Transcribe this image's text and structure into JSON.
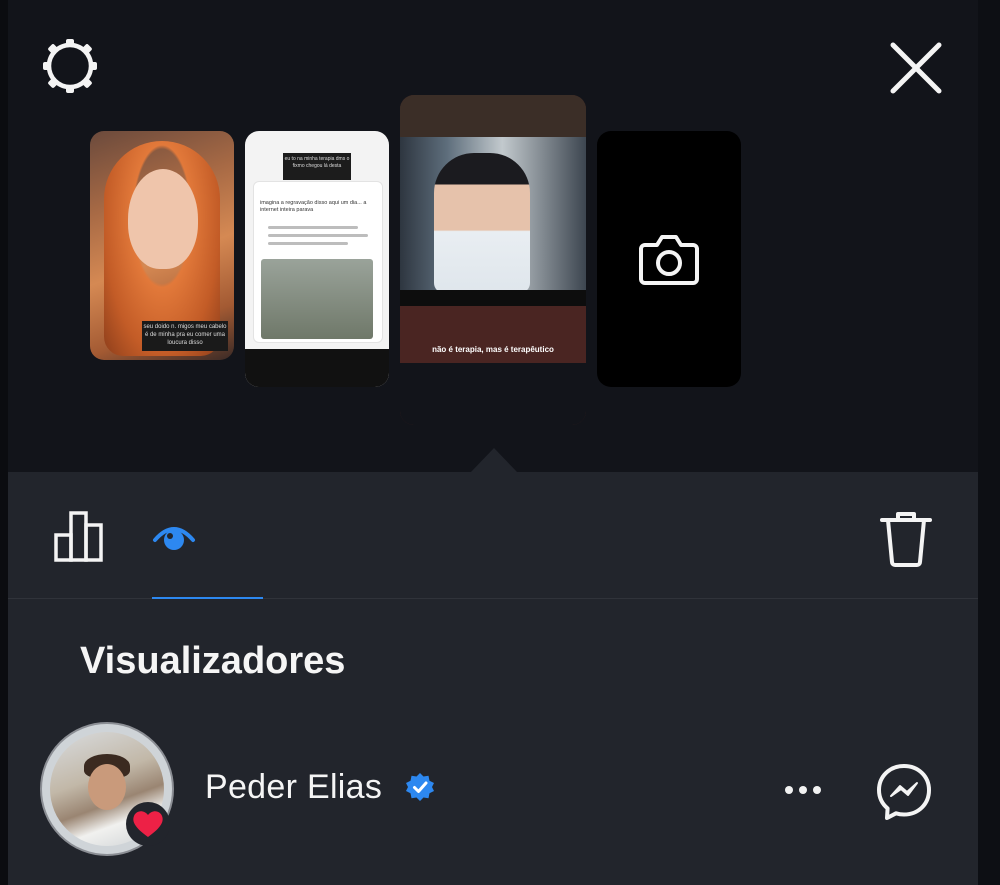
{
  "top": {
    "settings_icon": "gear-icon",
    "close_icon": "close-icon"
  },
  "stories": [
    {
      "type": "photo",
      "caption": "seu doido n. migos meu cabelo é de minha pra eu comer uma loucura disso"
    },
    {
      "type": "repost",
      "caption": "eu to na minha terapia dms o fixmo chegou lá desta",
      "post_text": "imagina a regravação disso aqui um dia... a internet inteira parava"
    },
    {
      "type": "video",
      "subtitle": "não é terapia, mas é terapêutico",
      "selected": true
    },
    {
      "type": "camera",
      "icon": "camera-icon"
    }
  ],
  "toolbar": {
    "insights_icon": "bar-chart-icon",
    "viewers_icon": "eye-icon",
    "delete_icon": "trash-icon"
  },
  "viewers": {
    "heading": "Visualizadores",
    "list": [
      {
        "name": "Peder Elias",
        "verified": true,
        "reacted": "heart",
        "more_icon": "more-icon",
        "message_icon": "messenger-icon"
      }
    ]
  },
  "colors": {
    "accent": "#2d88f0",
    "heart": "#ed2146",
    "panel": "#22252c",
    "background": "#12141a"
  }
}
